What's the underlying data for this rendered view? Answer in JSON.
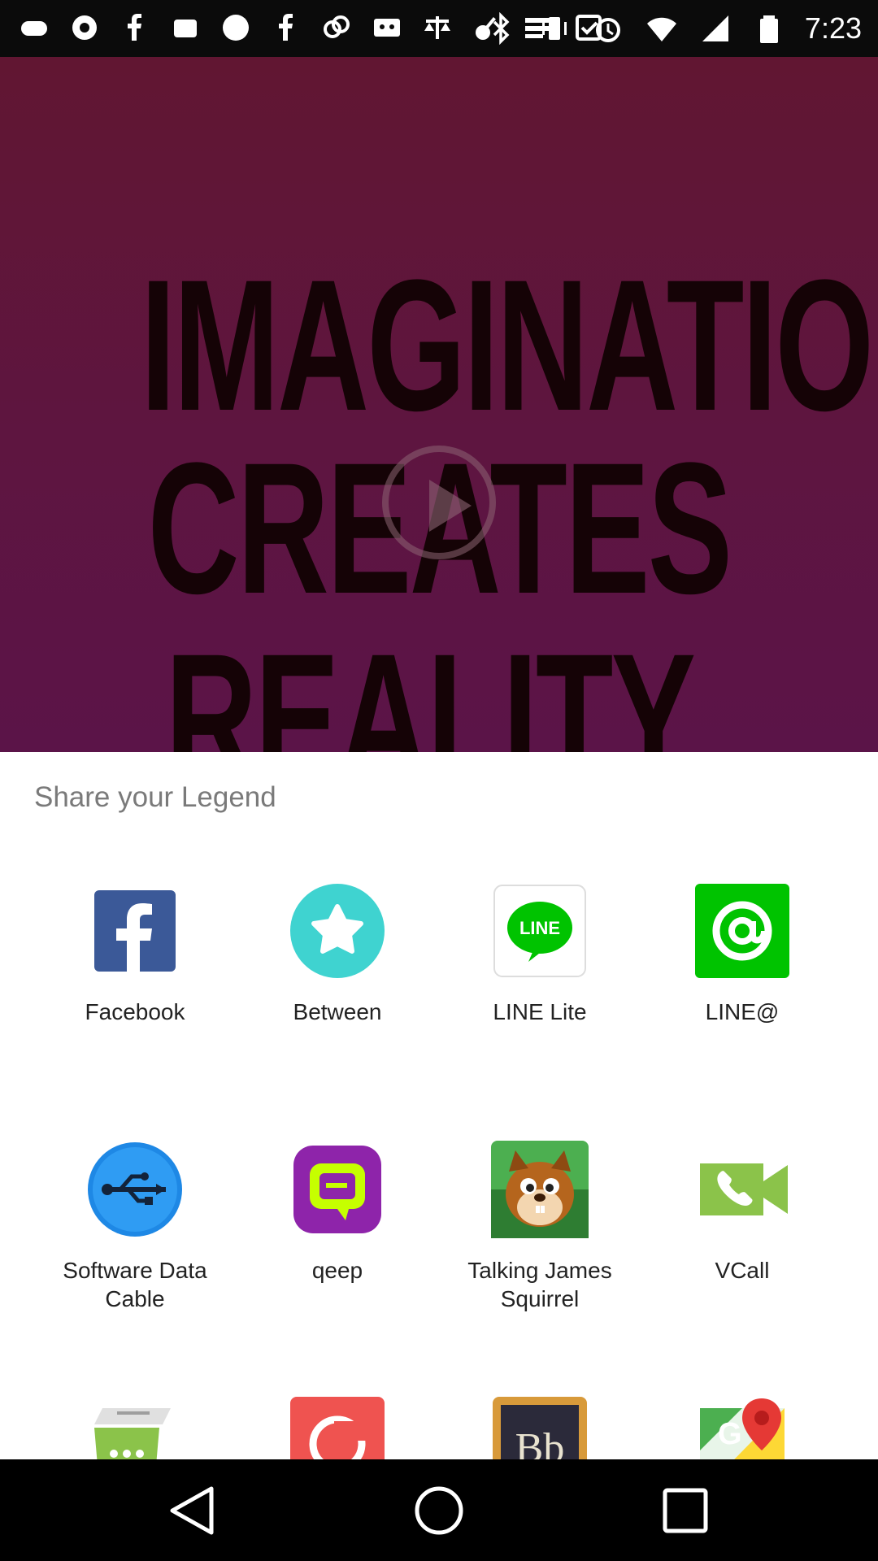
{
  "status_bar": {
    "time": "7:23",
    "left_icons": [
      "game-controller-icon",
      "steam-icon",
      "facebook-icon",
      "phone-icon",
      "usa-today-icon",
      "facebook-icon",
      "link-icon",
      "cassette-icon",
      "scale-icon",
      "guitar-icon",
      "news-icon",
      "checkbox-icon"
    ],
    "right_icons": [
      "bluetooth-icon",
      "vibrate-icon",
      "alarm-icon",
      "wifi-icon",
      "signal-icon",
      "battery-icon"
    ]
  },
  "video": {
    "poster_lines": [
      "IMAGINATION",
      "CREATES",
      "REALITY."
    ]
  },
  "share_sheet": {
    "title": "Share your Legend",
    "apps": [
      {
        "label": "Facebook",
        "icon": "facebook-icon"
      },
      {
        "label": "Between",
        "icon": "between-icon"
      },
      {
        "label": "LINE Lite",
        "icon": "line-lite-icon"
      },
      {
        "label": "LINE@",
        "icon": "line-at-icon"
      },
      {
        "label": "Software Data Cable",
        "icon": "usb-icon"
      },
      {
        "label": "qeep",
        "icon": "qeep-icon"
      },
      {
        "label": "Talking James Squirrel",
        "icon": "squirrel-icon"
      },
      {
        "label": "VCall",
        "icon": "vcall-icon"
      },
      {
        "label": "",
        "icon": "messaging-icon"
      },
      {
        "label": "",
        "icon": "app-red-icon"
      },
      {
        "label": "",
        "icon": "bb-icon"
      },
      {
        "label": "",
        "icon": "maps-icon"
      }
    ]
  },
  "nav_bar": {
    "buttons": [
      "back-icon",
      "home-icon",
      "recents-icon"
    ]
  },
  "colors": {
    "video_bg": "#611632",
    "facebook": "#3b5998",
    "between": "#3fd3d0",
    "line": "#00c300",
    "usb": "#1e88e5",
    "qeep": "#8e24aa",
    "vcall": "#8bc34a"
  }
}
